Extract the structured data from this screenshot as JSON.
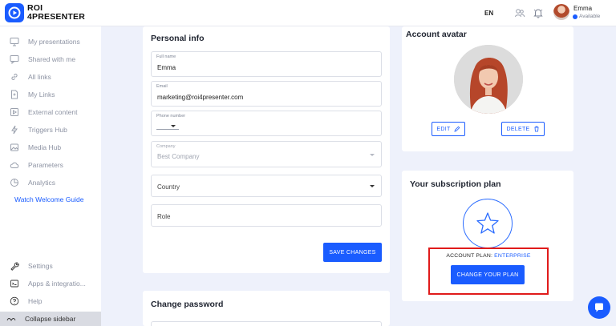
{
  "brand": {
    "name_line1": "ROI",
    "name_line2": "4PRESENTER"
  },
  "header": {
    "language": "EN",
    "user_name": "Emma",
    "user_status": "Available"
  },
  "sidebar": {
    "items": [
      {
        "label": "My presentations",
        "icon": "presentation-icon"
      },
      {
        "label": "Shared with me",
        "icon": "chat-icon"
      },
      {
        "label": "All links",
        "icon": "link-icon"
      },
      {
        "label": "My Links",
        "icon": "document-icon"
      },
      {
        "label": "External content",
        "icon": "external-content-icon"
      },
      {
        "label": "Triggers Hub",
        "icon": "lightning-icon"
      },
      {
        "label": "Media Hub",
        "icon": "image-icon"
      },
      {
        "label": "Parameters",
        "icon": "cloud-icon"
      },
      {
        "label": "Analytics",
        "icon": "analytics-icon"
      }
    ],
    "guide_link": "Watch Welcome Guide",
    "bottom_items": [
      {
        "label": "Settings",
        "icon": "wrench-icon"
      },
      {
        "label": "Apps & integratio...",
        "icon": "terminal-icon"
      },
      {
        "label": "Help",
        "icon": "help-icon"
      }
    ],
    "collapse_label": "Collapse sidebar"
  },
  "personal_info": {
    "title": "Personal info",
    "full_name_label": "Full name",
    "full_name_value": "Emma",
    "email_label": "Email",
    "email_value": "marketing@roi4presenter.com",
    "phone_label": "Phone number",
    "phone_value": "",
    "company_label": "Company",
    "company_value": "Best Company",
    "country_placeholder": "Country",
    "role_placeholder": "Role",
    "save_button": "SAVE CHANGES"
  },
  "change_password": {
    "title": "Change password"
  },
  "account_avatar": {
    "title": "Account avatar",
    "edit_button": "EDIT",
    "delete_button": "DELETE"
  },
  "subscription": {
    "title": "Your subscription plan",
    "plan_label": "ACCOUNT PLAN:",
    "plan_value": "ENTERPRISE",
    "change_button": "CHANGE YOUR PLAN"
  },
  "colors": {
    "accent": "#1a5cff",
    "highlight": "#e01b1b",
    "background": "#eef1fb"
  }
}
